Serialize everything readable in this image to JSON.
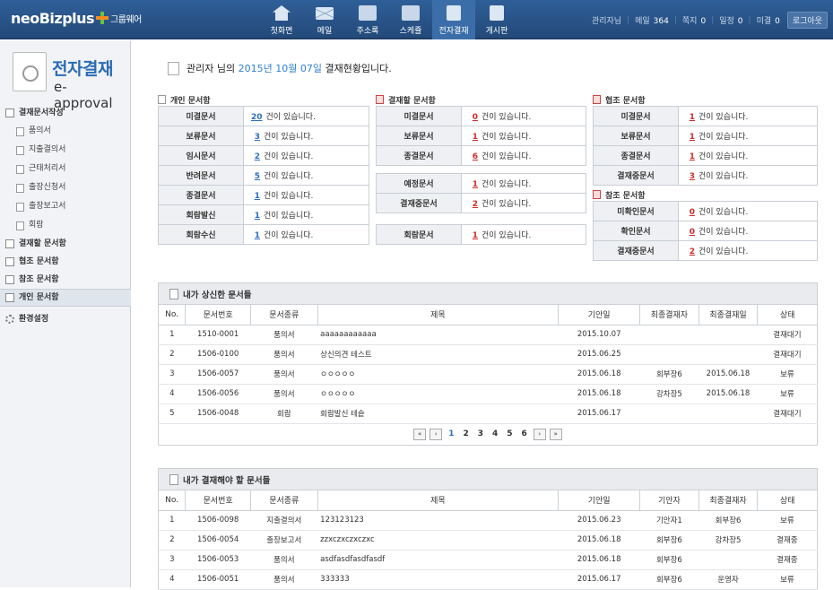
{
  "header": {
    "logo": "neoBizplus",
    "logo_sub": "그룹웨어",
    "nav": [
      {
        "label": "첫화면",
        "icon": "home-icon"
      },
      {
        "label": "메일",
        "icon": "mail-icon"
      },
      {
        "label": "주소록",
        "icon": "contacts-icon"
      },
      {
        "label": "스케쥴",
        "icon": "calendar-icon"
      },
      {
        "label": "전자결재",
        "icon": "approval-icon"
      },
      {
        "label": "게시판",
        "icon": "board-icon"
      }
    ],
    "user": "관리자님",
    "mail_label": "메일",
    "mail_count": "364",
    "note_label": "쪽지",
    "note_count": "0",
    "schedule_label": "일정",
    "schedule_count": "0",
    "pending_label": "미결",
    "pending_count": "0",
    "logout": "로그아웃"
  },
  "sidebar": {
    "title_ko": "전자결재",
    "title_en": "e-approval",
    "items": [
      {
        "label": "결재문서작성",
        "type": "group"
      },
      {
        "label": "품의서",
        "type": "sub"
      },
      {
        "label": "지출결의서",
        "type": "sub"
      },
      {
        "label": "근태처리서",
        "type": "sub"
      },
      {
        "label": "출장신청서",
        "type": "sub"
      },
      {
        "label": "출장보고서",
        "type": "sub"
      },
      {
        "label": "회람",
        "type": "sub"
      },
      {
        "label": "결재할 문서함",
        "type": "group"
      },
      {
        "label": "협조 문서함",
        "type": "group"
      },
      {
        "label": "참조 문서함",
        "type": "group"
      },
      {
        "label": "개인 문서함",
        "type": "group",
        "active": true
      },
      {
        "label": "환경설정",
        "type": "group"
      }
    ]
  },
  "main": {
    "heading_pre": "관리자 님의",
    "heading_date": "2015년 10월 07일",
    "heading_post": "결재현황입니다.",
    "personal": {
      "title": "개인 문서함",
      "rows": [
        {
          "label": "미결문서",
          "count": "20"
        },
        {
          "label": "보류문서",
          "count": "3"
        },
        {
          "label": "임시문서",
          "count": "2"
        },
        {
          "label": "반려문서",
          "count": "5"
        },
        {
          "label": "종결문서",
          "count": "1"
        },
        {
          "label": "회람발신",
          "count": "1"
        },
        {
          "label": "회람수신",
          "count": "1"
        }
      ]
    },
    "approve": {
      "title": "결재할 문서함",
      "rows": [
        {
          "label": "미결문서",
          "count": "0"
        },
        {
          "label": "보류문서",
          "count": "1"
        },
        {
          "label": "종결문서",
          "count": "6"
        }
      ],
      "rows2": [
        {
          "label": "예정문서",
          "count": "1"
        },
        {
          "label": "결재중문서",
          "count": "2"
        }
      ],
      "rows3": [
        {
          "label": "회람문서",
          "count": "1"
        }
      ]
    },
    "coop": {
      "title": "협조 문서함",
      "rows": [
        {
          "label": "미결문서",
          "count": "1"
        },
        {
          "label": "보류문서",
          "count": "1"
        },
        {
          "label": "종결문서",
          "count": "1"
        },
        {
          "label": "결재중문서",
          "count": "3"
        }
      ]
    },
    "ref": {
      "title": "참조 문서함",
      "rows": [
        {
          "label": "미확인문서",
          "count": "0"
        },
        {
          "label": "확인문서",
          "count": "0"
        },
        {
          "label": "결재중문서",
          "count": "2"
        }
      ]
    },
    "suffix": "건이 있습니다.",
    "sent": {
      "title": "내가 상신한 문서들",
      "columns": [
        "No.",
        "문서번호",
        "문서종류",
        "제목",
        "기안일",
        "최종결재자",
        "최종결재일",
        "상태"
      ],
      "rows": [
        [
          "1",
          "1510-0001",
          "품의서",
          "aaaaaaaaaaaa",
          "2015.10.07",
          "",
          "",
          "결재대기"
        ],
        [
          "2",
          "1506-0100",
          "품의서",
          "상신의견 테스트",
          "2015.06.25",
          "",
          "",
          "결재대기"
        ],
        [
          "3",
          "1506-0057",
          "품의서",
          "ㅇㅇㅇㅇㅇ",
          "2015.06.18",
          "회부장6",
          "2015.06.18",
          "보류"
        ],
        [
          "4",
          "1506-0056",
          "품의서",
          "ㅇㅇㅇㅇㅇ",
          "2015.06.18",
          "강차장5",
          "2015.06.18",
          "보류"
        ],
        [
          "5",
          "1506-0048",
          "회람",
          "회람발신 테슽",
          "2015.06.17",
          "",
          "",
          "결재대기"
        ]
      ],
      "pages": [
        "1",
        "2",
        "3",
        "4",
        "5",
        "6"
      ]
    },
    "todo": {
      "title": "내가 결재해야 할 문서들",
      "columns": [
        "No.",
        "문서번호",
        "문서종류",
        "제목",
        "기안일",
        "기안자",
        "최종결재자",
        "상태"
      ],
      "rows": [
        [
          "1",
          "1506-0098",
          "지출결의서",
          "123123123",
          "2015.06.23",
          "기안자1",
          "회부장6",
          "보류"
        ],
        [
          "2",
          "1506-0054",
          "출장보고서",
          "zzxczxczxczxc",
          "2015.06.18",
          "회부장6",
          "강차장5",
          "결재중"
        ],
        [
          "3",
          "1506-0053",
          "품의서",
          "asdfasdfasdfasdf",
          "2015.06.18",
          "회부장6",
          "",
          "결재중"
        ],
        [
          "4",
          "1506-0051",
          "품의서",
          "333333",
          "2015.06.17",
          "회부장6",
          "운영자",
          "보류"
        ]
      ]
    }
  }
}
